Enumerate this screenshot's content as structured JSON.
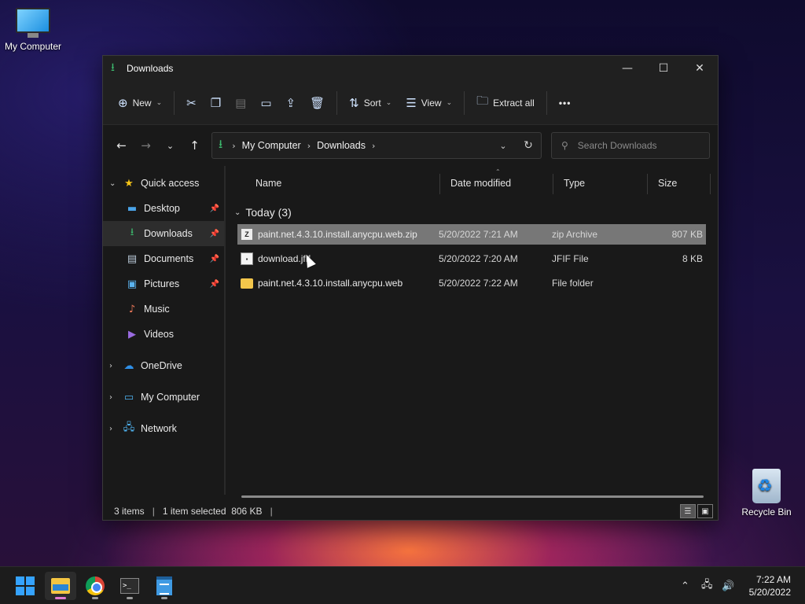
{
  "desktop": {
    "my_computer_label": "My Computer",
    "recycle_bin_label": "Recycle Bin"
  },
  "window": {
    "title": "Downloads",
    "minimize": "—",
    "maximize": "☐",
    "close": "✕"
  },
  "toolbar": {
    "new_label": "New",
    "sort_label": "Sort",
    "view_label": "View",
    "extract_label": "Extract all",
    "more_label": "•••"
  },
  "nav": {
    "breadcrumb": [
      "My Computer",
      "Downloads"
    ],
    "search_placeholder": "Search Downloads"
  },
  "sidebar": {
    "quick_access": "Quick access",
    "items": [
      {
        "label": "Desktop",
        "pinned": true
      },
      {
        "label": "Downloads",
        "pinned": true,
        "selected": true
      },
      {
        "label": "Documents",
        "pinned": true
      },
      {
        "label": "Pictures",
        "pinned": true
      },
      {
        "label": "Music",
        "pinned": false
      },
      {
        "label": "Videos",
        "pinned": false
      }
    ],
    "onedrive": "OneDrive",
    "my_computer": "My Computer",
    "network": "Network"
  },
  "columns": {
    "name": "Name",
    "date": "Date modified",
    "type": "Type",
    "size": "Size"
  },
  "group": {
    "label": "Today (3)"
  },
  "files": [
    {
      "name": "paint.net.4.3.10.install.anycpu.web.zip",
      "date": "5/20/2022 7:21 AM",
      "type": "zip Archive",
      "size": "807 KB",
      "icon": "zip-icon",
      "selected": true
    },
    {
      "name": "download.jfif",
      "date": "5/20/2022 7:20 AM",
      "type": "JFIF File",
      "size": "8 KB",
      "icon": "image-file-icon",
      "selected": false
    },
    {
      "name": "paint.net.4.3.10.install.anycpu.web",
      "date": "5/20/2022 7:22 AM",
      "type": "File folder",
      "size": "",
      "icon": "folder-icon",
      "selected": false
    }
  ],
  "status": {
    "items": "3 items",
    "selected": "1 item selected  806 KB"
  },
  "taskbar": {
    "time": "7:22 AM",
    "date": "5/20/2022"
  }
}
